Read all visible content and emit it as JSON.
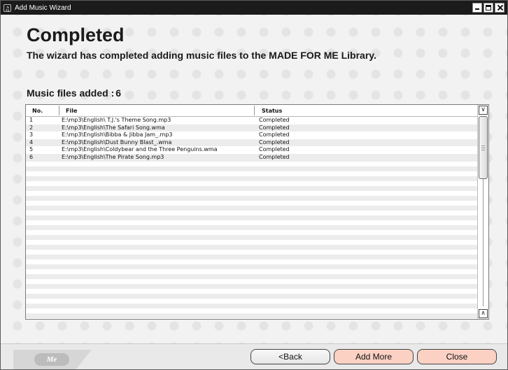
{
  "window": {
    "title": "Add Music Wizard"
  },
  "main": {
    "heading": "Completed",
    "subheading": "The wizard has completed adding music files to the MADE FOR ME Library.",
    "files_added_label": "Music files added :",
    "files_added_count": "6"
  },
  "table": {
    "columns": {
      "no": "No.",
      "file": "File",
      "status": "Status"
    },
    "rows": [
      {
        "no": "1",
        "file": "E:\\mp3\\English\\ T.J.'s Theme Song.mp3",
        "status": "Completed"
      },
      {
        "no": "2",
        "file": "E:\\mp3\\English\\The Safari Song.wma",
        "status": "Completed"
      },
      {
        "no": "3",
        "file": "E:\\mp3\\English\\Bibba & Jibba Jam_.mp3",
        "status": "Completed"
      },
      {
        "no": "4",
        "file": "E:\\mp3\\English\\Dust Bunny Blast_.wma",
        "status": "Completed"
      },
      {
        "no": "5",
        "file": "E:\\mp3\\English\\Coldybear and the Three Penguins.wma",
        "status": "Completed"
      },
      {
        "no": "6",
        "file": "E:\\mp3\\English\\The Pirate Song.mp3",
        "status": "Completed"
      }
    ]
  },
  "footer": {
    "logo_text": "Made for Me",
    "back_label": "<Back",
    "add_more_label": "Add More",
    "close_label": "Close"
  },
  "colors": {
    "titlebar": "#1b1b1b",
    "action_button": "#fbd1c4",
    "background": "#f2f2f2"
  },
  "icons": {
    "app": "music-wizard-icon",
    "minimize": "minimize-icon",
    "maximize": "maximize-icon",
    "close": "close-icon",
    "scroll_down": "chevron-down-icon",
    "scroll_up": "chevron-up-icon"
  }
}
